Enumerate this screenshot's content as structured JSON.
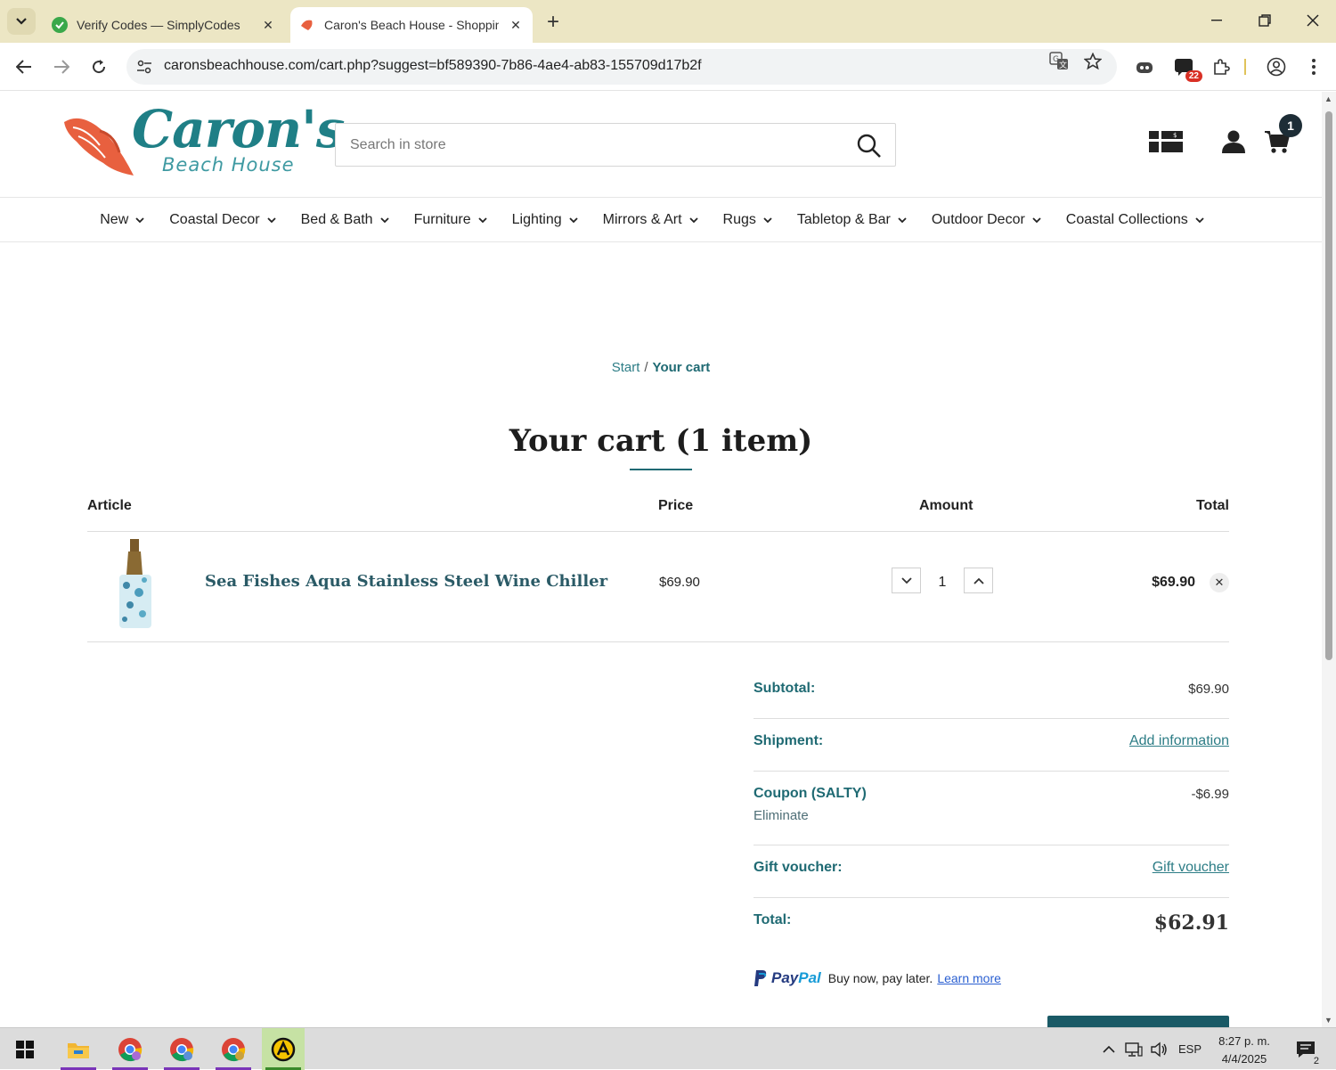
{
  "browser": {
    "tabs": [
      {
        "title": "Verify Codes — SimplyCodes",
        "active": false
      },
      {
        "title": "Caron's Beach House - Shoppin",
        "active": true
      }
    ],
    "url": "caronsbeachhouse.com/cart.php?suggest=bf589390-7b86-4ae4-ab83-155709d17b2f",
    "extension_badge": "22"
  },
  "header": {
    "logo_brand": "Caron's",
    "logo_sub": "Beach House",
    "search_placeholder": "Search in store",
    "cart_count": "1"
  },
  "nav": {
    "items": [
      {
        "label": "New"
      },
      {
        "label": "Coastal Decor"
      },
      {
        "label": "Bed & Bath"
      },
      {
        "label": "Furniture"
      },
      {
        "label": "Lighting"
      },
      {
        "label": "Mirrors & Art"
      },
      {
        "label": "Rugs"
      },
      {
        "label": "Tabletop & Bar"
      },
      {
        "label": "Outdoor Decor"
      },
      {
        "label": "Coastal Collections"
      }
    ]
  },
  "breadcrumb": {
    "start": "Start",
    "separator": "/",
    "current": "Your cart"
  },
  "cart": {
    "title": "Your cart (1 item)",
    "columns": {
      "article": "Article",
      "price": "Price",
      "amount": "Amount",
      "total": "Total"
    },
    "items": [
      {
        "name": "Sea Fishes Aqua Stainless Steel Wine Chiller",
        "price": "$69.90",
        "quantity": "1",
        "total": "$69.90"
      }
    ],
    "summary": {
      "subtotal_label": "Subtotal:",
      "subtotal_value": "$69.90",
      "shipment_label": "Shipment:",
      "shipment_link": "Add information",
      "coupon_label": "Coupon (SALTY)",
      "coupon_value": "-$6.99",
      "coupon_remove": "Eliminate",
      "gift_label": "Gift voucher:",
      "gift_link": "Gift voucher",
      "total_label": "Total:",
      "total_value": "$62.91"
    },
    "paypal": {
      "brand_a": "Pay",
      "brand_b": "Pal",
      "text": "Buy now, pay later.",
      "link": "Learn more"
    }
  },
  "taskbar": {
    "language": "ESP",
    "time": "8:27 p. m.",
    "date": "4/4/2025",
    "notifications": "2"
  },
  "colors": {
    "brand_teal": "#1f7f86",
    "link_teal": "#2d7d86",
    "tabbar_bg": "#ece6c4",
    "shell_coral": "#e8603f"
  }
}
